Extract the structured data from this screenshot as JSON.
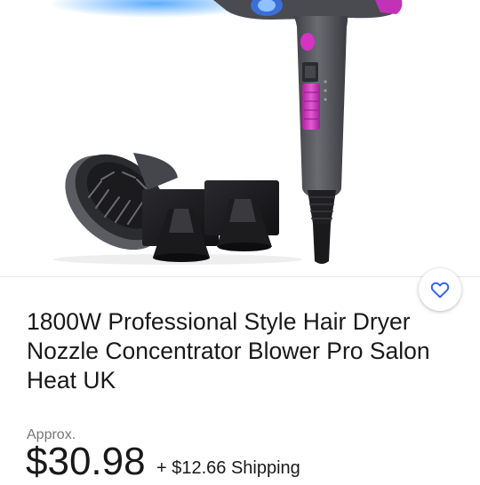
{
  "product": {
    "image_alt": "Hair dryer with diffuser and concentrator nozzles",
    "title": "1800W Professional Style Hair Dryer Nozzle Concentrator Blower Pro Salon Heat UK",
    "price_prefix": "Approx.",
    "price": "$30.98",
    "shipping": "+ $12.66 Shipping"
  },
  "icons": {
    "watch": "heart-outline-icon"
  },
  "colors": {
    "accent_pink": "#d433c4",
    "body_gray": "#55565b",
    "text": "#191919",
    "muted": "#767676",
    "watch_icon": "#3665f3"
  }
}
